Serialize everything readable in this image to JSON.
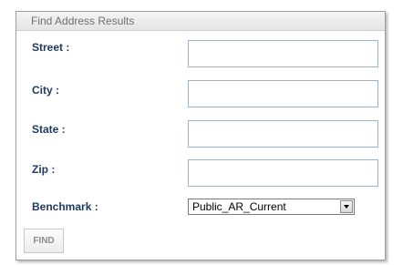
{
  "panel": {
    "title": "Find Address Results"
  },
  "form": {
    "street_label": "Street :",
    "street_value": "",
    "city_label": "City :",
    "city_value": "",
    "state_label": "State :",
    "state_value": "",
    "zip_label": "Zip :",
    "zip_value": "",
    "benchmark_label": "Benchmark :",
    "benchmark_selected": "Public_AR_Current",
    "find_label": "FIND"
  },
  "colors": {
    "label_text": "#1f3b63",
    "input_border": "#9bb4cc",
    "header_text": "#6f6f6f",
    "button_text": "#8c8c8c"
  },
  "icons": {
    "select_arrow": "chevron-down-icon"
  }
}
